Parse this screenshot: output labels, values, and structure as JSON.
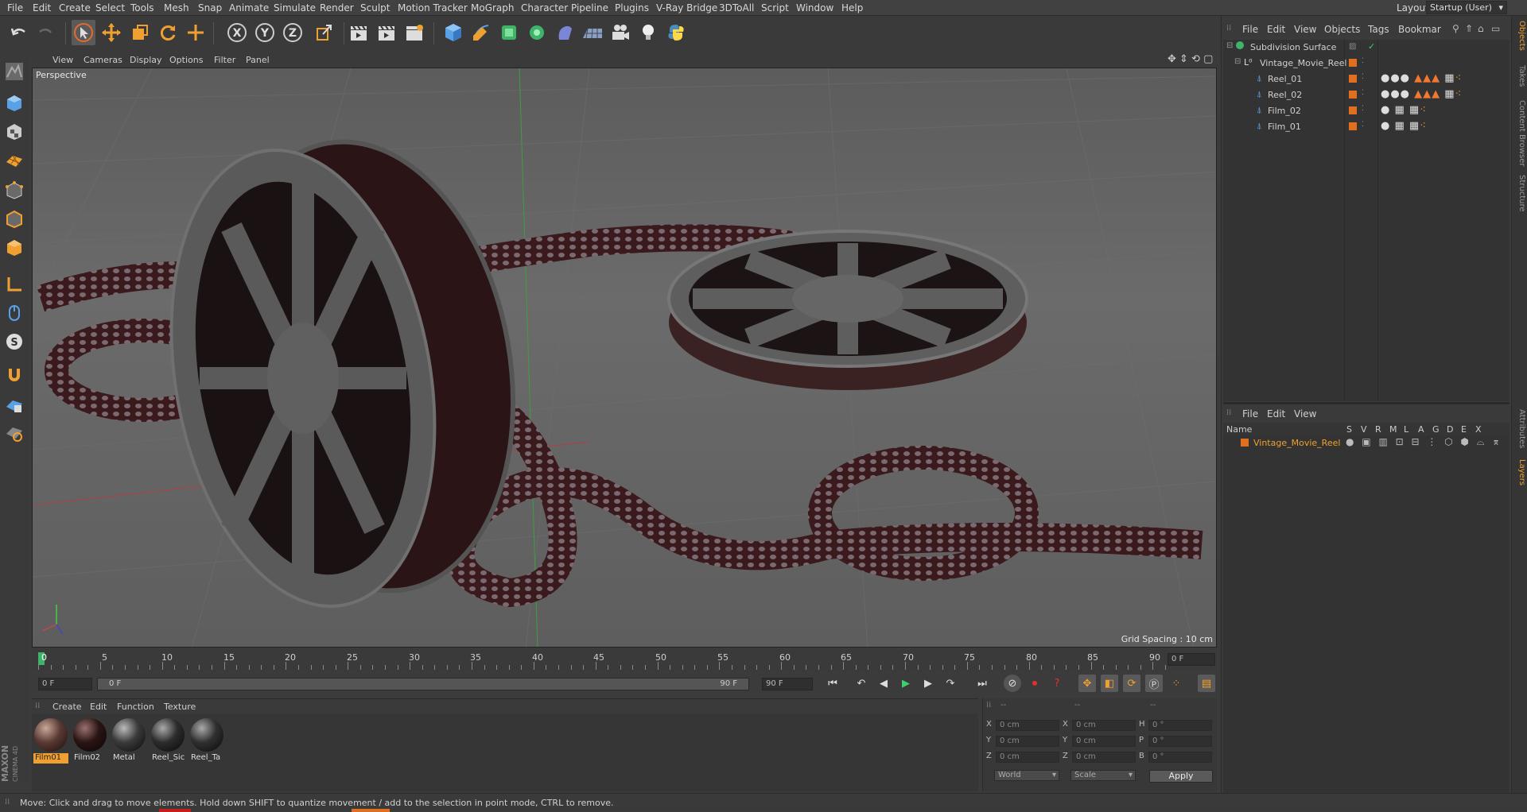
{
  "menubar": {
    "items": [
      "File",
      "Edit",
      "Create",
      "Select",
      "Tools",
      "Mesh",
      "Snap",
      "Animate",
      "Simulate",
      "Render",
      "Sculpt",
      "Motion Tracker",
      "MoGraph",
      "Character",
      "Pipeline",
      "Plugins",
      "V-Ray Bridge",
      "3DToAll",
      "Script",
      "Window",
      "Help"
    ],
    "layout_label": "Layout:",
    "layout_value": "Startup (User)"
  },
  "toolbar": {
    "axis_x": "X",
    "axis_y": "Y",
    "axis_z": "Z"
  },
  "viewport": {
    "menu": [
      "View",
      "Cameras",
      "Display",
      "Options",
      "Filter",
      "Panel"
    ],
    "label": "Perspective",
    "grid_spacing": "Grid Spacing : 10 cm"
  },
  "timeline": {
    "ticks": [
      "0",
      "5",
      "10",
      "15",
      "20",
      "25",
      "30",
      "35",
      "40",
      "45",
      "50",
      "55",
      "60",
      "65",
      "70",
      "75",
      "80",
      "85",
      "90"
    ],
    "current_frame": "0 F",
    "start_field": "0 F",
    "range_start": "0 F",
    "range_end": "90 F",
    "end_field": "90 F"
  },
  "material_manager": {
    "menu": [
      "Create",
      "Edit",
      "Function",
      "Texture"
    ],
    "materials": [
      {
        "name": "Film01",
        "color": "#5a3a34",
        "selected": true
      },
      {
        "name": "Film02",
        "color": "#2a1414",
        "selected": false
      },
      {
        "name": "Metal",
        "color": "#3a3a3a",
        "selected": false
      },
      {
        "name": "Reel_Sic",
        "color": "#2c2c2c",
        "selected": false
      },
      {
        "name": "Reel_Ta",
        "color": "#303030",
        "selected": false
      }
    ]
  },
  "coordinates": {
    "headers": [
      "--",
      "--",
      "--"
    ],
    "pos_x": "0 cm",
    "pos_y": "0 cm",
    "pos_z": "0 cm",
    "scl_x": "0 cm",
    "scl_y": "0 cm",
    "scl_z": "0 cm",
    "rot_h": "0 °",
    "rot_p": "0 °",
    "rot_b": "0 °",
    "labels": {
      "x": "X",
      "y": "Y",
      "z": "Z",
      "h": "H",
      "p": "P",
      "b": "B"
    },
    "mode1": "World",
    "mode2": "Scale",
    "apply": "Apply"
  },
  "statusbar": {
    "text": "Move: Click and drag to move elements. Hold down SHIFT to quantize movement / add to the selection in point mode, CTRL to remove."
  },
  "object_manager": {
    "menu": [
      "File",
      "Edit",
      "View",
      "Objects",
      "Tags",
      "Bookmar"
    ],
    "objects": [
      {
        "name": "Subdivision Surface"
      },
      {
        "name": "Vintage_Movie_Reel"
      },
      {
        "name": "Reel_01"
      },
      {
        "name": "Reel_02"
      },
      {
        "name": "Film_02"
      },
      {
        "name": "Film_01"
      }
    ]
  },
  "layer_manager": {
    "menu": [
      "File",
      "Edit",
      "View"
    ],
    "columns": [
      "Name",
      "S",
      "V",
      "R",
      "M",
      "L",
      "A",
      "G",
      "D",
      "E",
      "X"
    ],
    "layers": [
      {
        "name": "Vintage_Movie_Reel"
      }
    ]
  },
  "side_tabs": [
    "Objects",
    "Takes",
    "Content Browser",
    "Structure",
    "Attributes",
    "Layers"
  ],
  "branding": {
    "maxon": "MAXON",
    "product": "CINEMA 4D"
  }
}
